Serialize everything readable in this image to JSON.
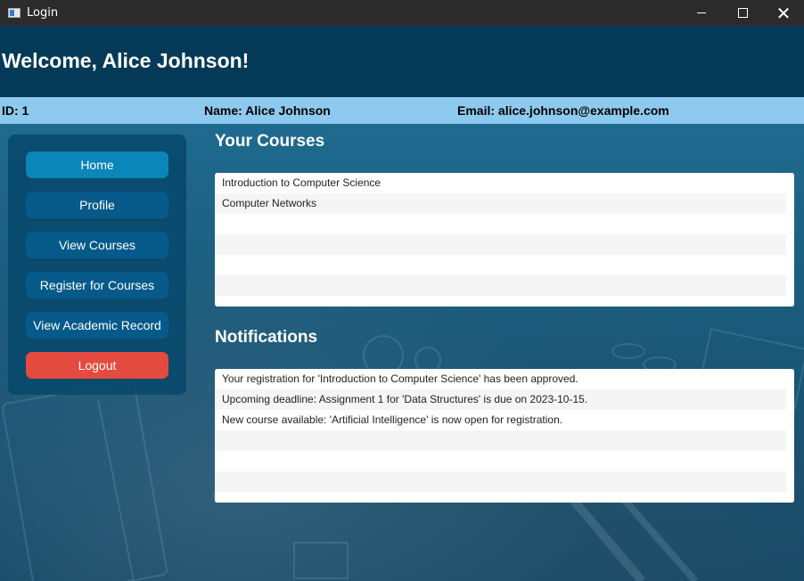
{
  "window": {
    "title": "Login",
    "icon": "app-window-icon",
    "controls": [
      "minimize-icon",
      "maximize-icon",
      "close-icon"
    ],
    "close_glyph": "✕"
  },
  "header": {
    "welcome": "Welcome, Alice Johnson!",
    "background": "#043a57"
  },
  "info": {
    "id": "ID: 1",
    "name": "Name: Alice Johnson",
    "email": "Email: alice.johnson@example.com",
    "background": "#8ec9ef"
  },
  "sidebar": {
    "items": [
      {
        "label": "Home",
        "active": true
      },
      {
        "label": "Profile"
      },
      {
        "label": "View Courses"
      },
      {
        "label": "Register for Courses"
      },
      {
        "label": "View Academic Record"
      },
      {
        "label": "Logout",
        "color": "#e44a3d"
      }
    ]
  },
  "courses": {
    "title": "Your Courses",
    "items": [
      "Introduction to Computer Science",
      "Computer Networks",
      "",
      "",
      "",
      ""
    ]
  },
  "notifications": {
    "title": "Notifications",
    "items": [
      "Your registration for 'Introduction to Computer Science' has been approved.",
      "Upcoming deadline: Assignment 1 for 'Data Structures' is due on 2023-10-15.",
      "New course available: 'Artificial Intelligence' is now open for registration.",
      "",
      "",
      ""
    ]
  }
}
